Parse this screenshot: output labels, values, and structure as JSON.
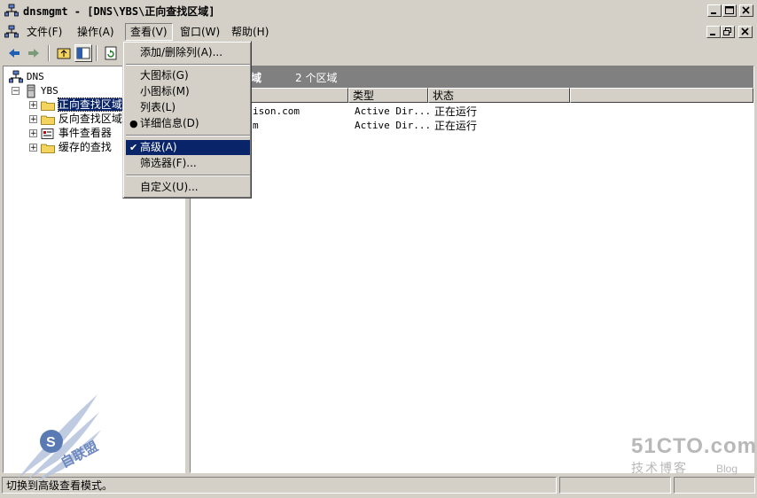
{
  "window": {
    "title": "dnsmgmt - [DNS\\YBS\\正向查找区域]"
  },
  "menubar": {
    "items": [
      {
        "label": "文件(F)"
      },
      {
        "label": "操作(A)"
      },
      {
        "label": "查看(V)"
      },
      {
        "label": "窗口(W)"
      },
      {
        "label": "帮助(H)"
      }
    ]
  },
  "view_menu": {
    "items": [
      {
        "label": "添加/删除列(A)..."
      },
      {
        "label": "大图标(G)"
      },
      {
        "label": "小图标(M)"
      },
      {
        "label": "列表(L)"
      },
      {
        "label": "详细信息(D)",
        "mark": "●"
      },
      {
        "label": "高级(A)",
        "mark": "✔"
      },
      {
        "label": "筛选器(F)..."
      },
      {
        "label": "自定义(U)..."
      }
    ]
  },
  "tree": {
    "root": "DNS",
    "server": "YBS",
    "children": [
      {
        "label": "正向查找区域"
      },
      {
        "label": "反向查找区域"
      },
      {
        "label": "事件查看器"
      },
      {
        "label": "缓存的查找"
      }
    ]
  },
  "detail": {
    "header_title": "区域",
    "header_count": "2 个区域",
    "columns": [
      "",
      "类型",
      "状态"
    ],
    "rows": [
      {
        "name": "ison.com",
        "type": "Active Dir...",
        "status": "正在运行"
      },
      {
        "name": "m",
        "type": "Active Dir...",
        "status": "正在运行"
      }
    ]
  },
  "statusbar": {
    "text": "切换到高级查看模式。"
  },
  "watermark_left": {
    "text": "自联盟"
  },
  "watermark_right": {
    "brand": "51CTO.com",
    "sub": "技术博客",
    "blog": "Blog"
  },
  "colors": {
    "selection": "#0a246a",
    "face": "#d4d0c8",
    "header_gray": "#808080"
  }
}
